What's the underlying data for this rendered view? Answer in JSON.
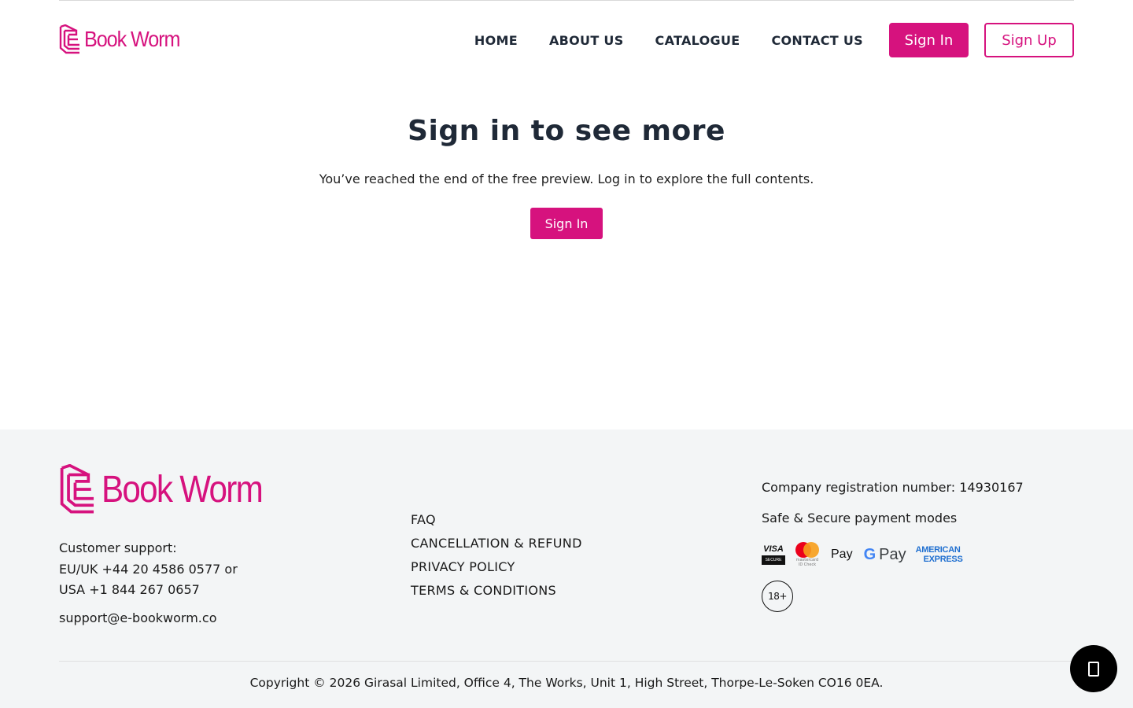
{
  "brand": {
    "name": "Book Worm",
    "color": "#d6127e"
  },
  "header": {
    "nav": [
      "HOME",
      "ABOUT US",
      "CATALOGUE",
      "CONTACT US"
    ],
    "sign_in": "Sign In",
    "sign_up": "Sign Up"
  },
  "main": {
    "title": "Sign in to see more",
    "message": "You’ve reached the end of the free preview. Log in to explore the full contents.",
    "sign_in": "Sign In"
  },
  "footer": {
    "support_label": "Customer support:",
    "support_eu": "EU/UK +44 20 4586 0577 or",
    "support_usa": "USA +1 844 267 0657",
    "email": "support@e-bookworm.co",
    "links": [
      "FAQ",
      "CANCELLATION & REFUND",
      "PRIVACY POLICY",
      "TERMS & CONDITIONS"
    ],
    "registration": "Company registration number: 14930167",
    "payment_title": "Safe & Secure payment modes",
    "payments": {
      "visa": "VISA",
      "visa_sub": "SECURE",
      "mastercard_sub": "mastercard ID Check",
      "apple_pay": " Pay",
      "google_g": "G",
      "google_pay": "Pay",
      "amex_1": "AMERICAN",
      "amex_2": "EXPRESS"
    },
    "age": "18+",
    "copyright": "Copyright © 2026 Girasal Limited, Office 4, The Works, Unit 1, High Street, Thorpe-Le-Soken CO16 0EA."
  },
  "icons": {
    "logo": "book-stack-icon",
    "chat": "chat-icon"
  }
}
